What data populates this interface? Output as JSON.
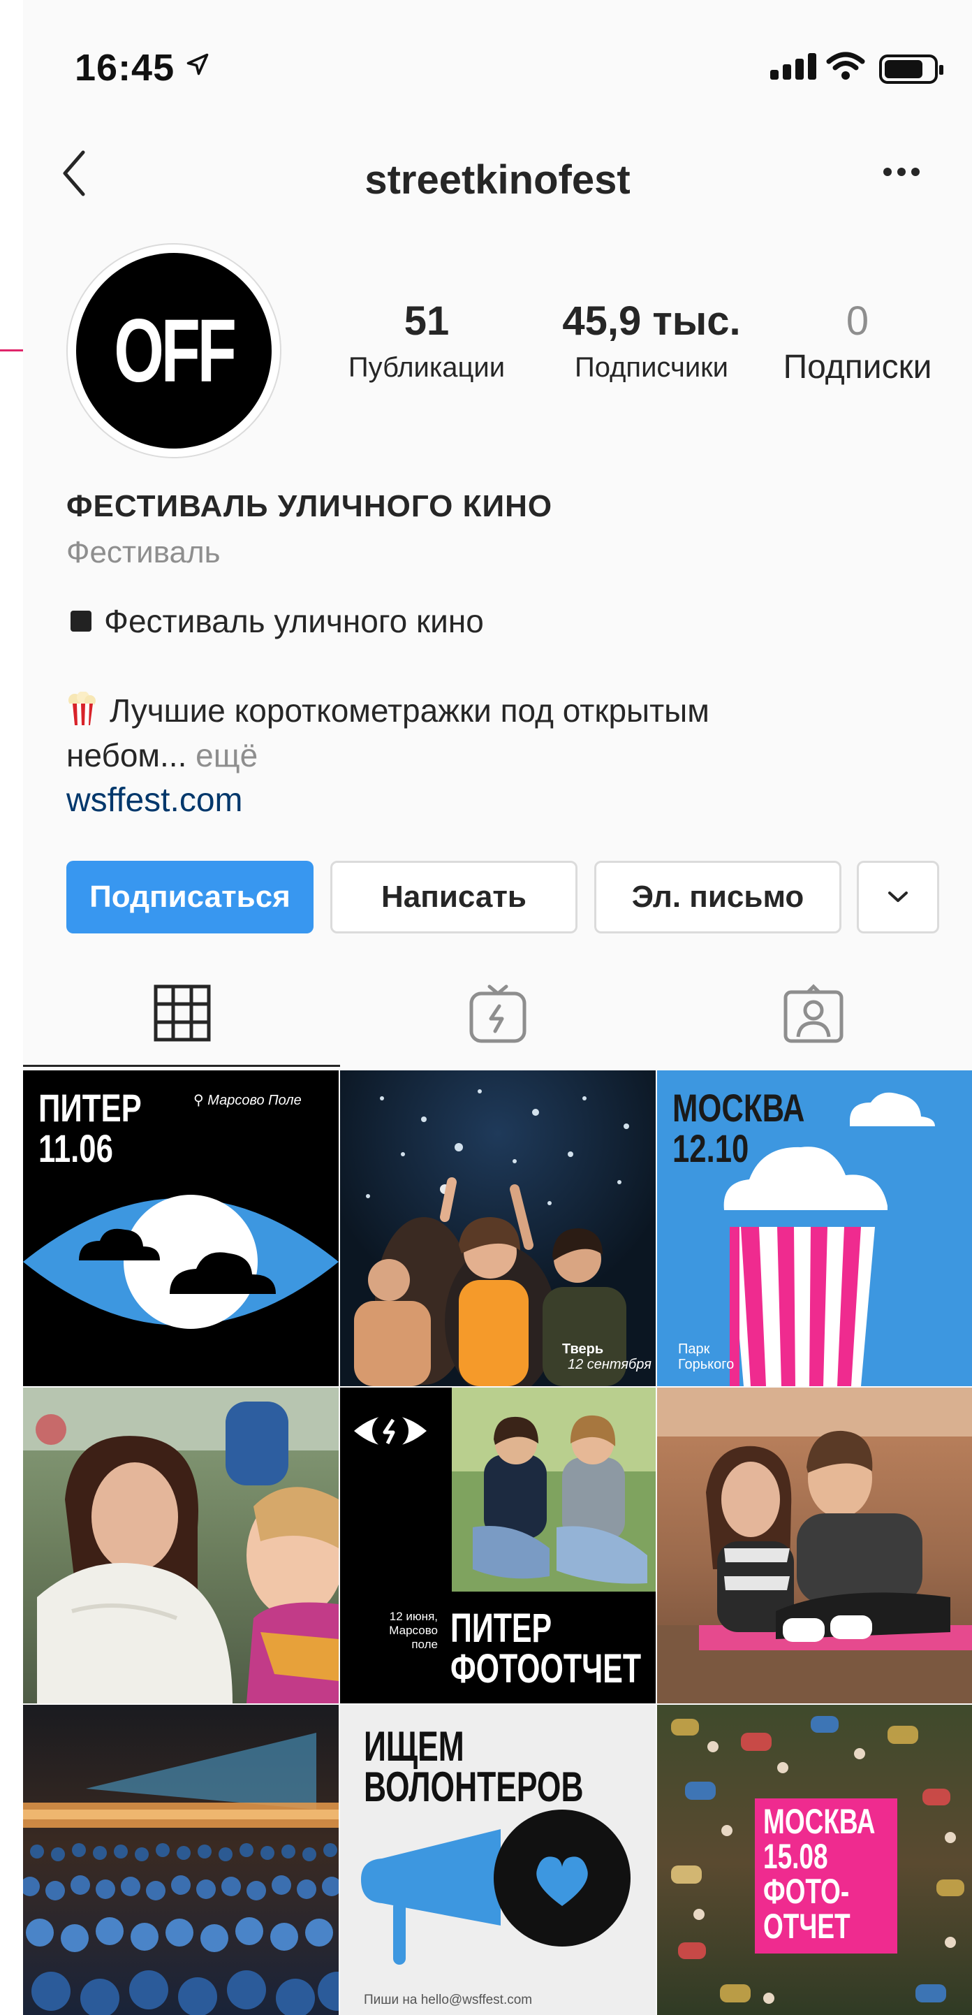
{
  "status_bar": {
    "time": "16:45"
  },
  "header": {
    "username": "streetkinofest"
  },
  "avatar": {
    "text": "OFF"
  },
  "stats": [
    {
      "value": "51",
      "label": "Публикации"
    },
    {
      "value": "45,9 тыс.",
      "label": "Подписчики"
    },
    {
      "value": "0",
      "label": "Подписки"
    }
  ],
  "bio": {
    "name": "ФЕСТИВАЛЬ УЛИЧНОГО КИНО",
    "category": "Фестиваль",
    "line1": "Фестиваль уличного кино",
    "line2": "Лучшие короткометражки под открытым",
    "line3": "небом...",
    "more": "ещё",
    "url": "wsffest.com"
  },
  "buttons": {
    "follow": "Подписаться",
    "message": "Написать",
    "email": "Эл. письмо"
  },
  "tabs": [
    {
      "icon": "grid-icon",
      "active": true
    },
    {
      "icon": "igtv-icon",
      "active": false
    },
    {
      "icon": "tagged-icon",
      "active": false
    }
  ],
  "posts": {
    "p1": {
      "title1": "ПИТЕР",
      "title2": "11.06",
      "place": "Марсово Поле"
    },
    "p2": {
      "place": "Тверь",
      "date": "12 сентября"
    },
    "p3": {
      "title1": "МОСКВА",
      "title2": "12.10",
      "place1": "Парк",
      "place2": "Горького"
    },
    "p5": {
      "note1": "12 июня,",
      "note2": "Марсово",
      "note3": "поле",
      "title1": "ПИТЕР",
      "title2": "ФОТООТЧЕТ"
    },
    "p8": {
      "title1": "ИЩЕМ",
      "title2": "ВОЛОНТЕРОВ",
      "contact": "Пиши на hello@wsffest.com"
    },
    "p9": {
      "line1": "МОСКВА",
      "line2": "15.08",
      "line3": "ФОТО-",
      "line4": "ОТЧЕТ"
    }
  },
  "colors": {
    "accent_blue": "#3897f0",
    "poster_blue": "#3d97e0",
    "poster_pink": "#ef2b8f",
    "link": "#00376b"
  }
}
